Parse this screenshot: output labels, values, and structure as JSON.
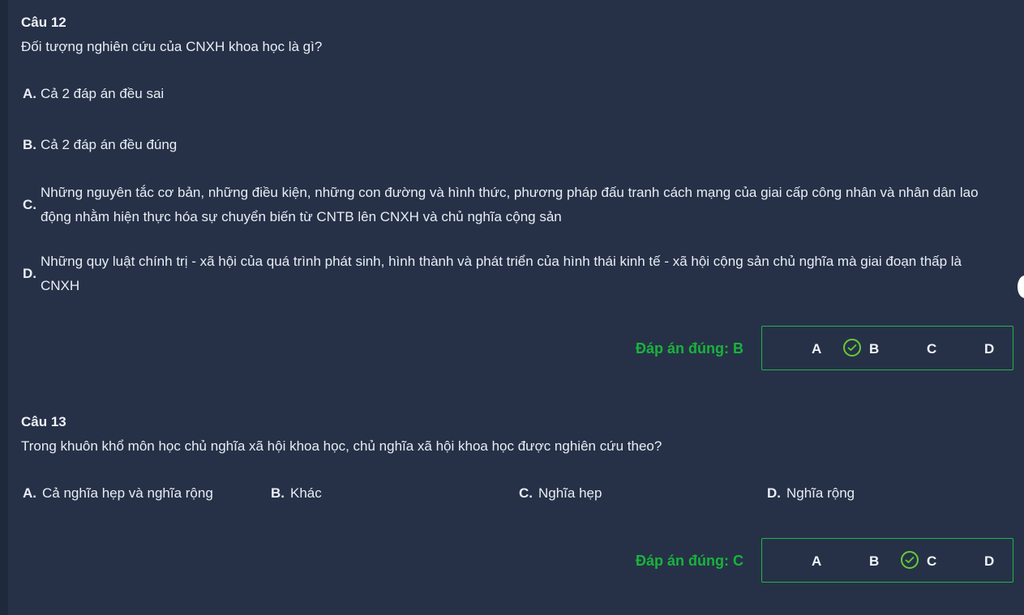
{
  "questions": [
    {
      "title": "Câu 12",
      "text": "Đối tượng nghiên cứu của CNXH khoa học là gì?",
      "options": [
        {
          "letter": "A.",
          "text": "Cả 2 đáp án đều sai"
        },
        {
          "letter": "B.",
          "text": "Cả 2 đáp án đều đúng"
        },
        {
          "letter": "C.",
          "line1": "Những nguyên tắc cơ bản, những điều kiện, những con đường và hình thức, phương pháp đấu tranh cách mạng của giai cấp công nhân và nhân dân lao",
          "line2": "động nhằm hiện thực hóa sự chuyển biến từ CNTB lên CNXH và chủ nghĩa cộng sản"
        },
        {
          "letter": "D.",
          "line1": "Những quy luật chính trị - xã hội của quá trình phát sinh, hình thành và phát triển của hình thái kinh tế - xã hội cộng sản chủ nghĩa mà giai đoạn thấp là",
          "line2": "CNXH"
        }
      ],
      "answer_label": "Đáp án đúng: B",
      "choices": [
        "A",
        "B",
        "C",
        "D"
      ],
      "correct": "B"
    },
    {
      "title": "Câu 13",
      "text": "Trong khuôn khổ môn học chủ nghĩa xã hội khoa học, chủ nghĩa xã hội khoa học được nghiên cứu theo?",
      "options": [
        {
          "letter": "A.",
          "text": "Cả nghĩa hẹp và nghĩa rộng"
        },
        {
          "letter": "B.",
          "text": "Khác"
        },
        {
          "letter": "C.",
          "text": "Nghĩa hẹp"
        },
        {
          "letter": "D.",
          "text": "Nghĩa rộng"
        }
      ],
      "answer_label": "Đáp án đúng: C",
      "choices": [
        "A",
        "B",
        "C",
        "D"
      ],
      "correct": "C"
    }
  ],
  "colors": {
    "background": "#263148",
    "correct_green": "#19b33b",
    "check_green": "#66cc33"
  },
  "icons": {
    "check": "check-circle-icon"
  }
}
